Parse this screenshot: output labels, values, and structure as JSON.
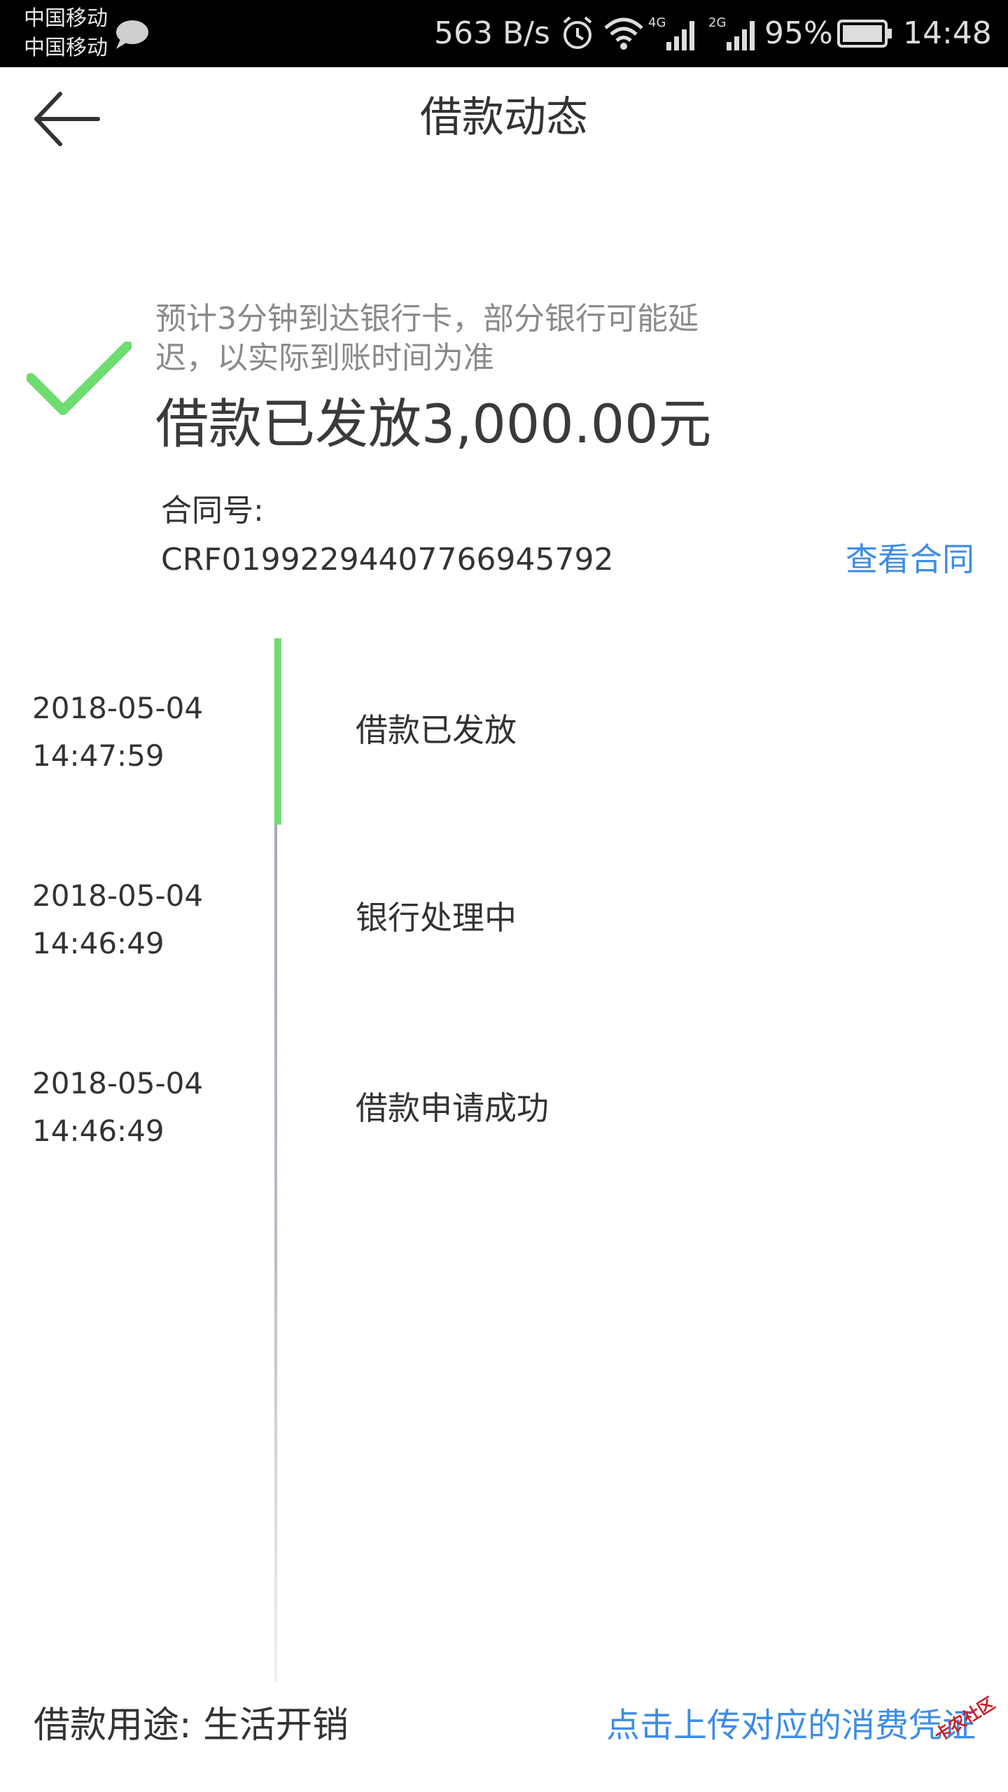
{
  "status_bar": {
    "carrier_1": "中国移动",
    "carrier_2": "中国移动",
    "net_speed": "563 B/s",
    "signal_1_label": "4G",
    "signal_2_label": "2G",
    "battery": "95%",
    "time": "14:48",
    "icons": [
      "message-icon",
      "alarm-icon",
      "wifi-icon",
      "signal-icon",
      "battery-icon"
    ]
  },
  "header": {
    "title": "借款动态",
    "back_icon": "arrow-left-icon"
  },
  "status": {
    "icon": "check-icon",
    "icon_color": "#6fdc6f",
    "note": "预计3分钟到达银行卡，部分银行可能延迟，以实际到账时间为准",
    "amount_text": "借款已发放3,000.00元",
    "contract_label": "合同号:",
    "contract_number": "CRF01992294407766945792",
    "view_contract": "查看合同"
  },
  "timeline": [
    {
      "date": "2018-05-04",
      "time": "14:47:59",
      "event": "借款已发放",
      "active": true
    },
    {
      "date": "2018-05-04",
      "time": "14:46:49",
      "event": "银行处理中",
      "active": false
    },
    {
      "date": "2018-05-04",
      "time": "14:46:49",
      "event": "借款申请成功",
      "active": false
    }
  ],
  "footer": {
    "purpose": "借款用途: 生活开销",
    "upload_link": "点击上传对应的消费凭证"
  },
  "watermark": "卡农社区",
  "colors": {
    "accent_blue": "#3e8ce6",
    "success_green": "#6fdc6f",
    "text_dark": "#333333",
    "text_gray": "#8a8a8a"
  }
}
